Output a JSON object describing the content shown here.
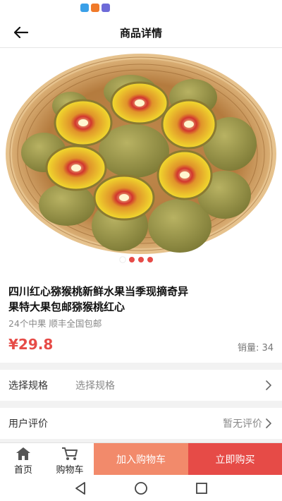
{
  "header": {
    "title": "商品详情"
  },
  "gallery": {
    "active_index": 0,
    "dot_count": 4
  },
  "product": {
    "title": "四川红心猕猴桃新鲜水果当季现摘奇异果特大果包邮猕猴桃红心",
    "title_line1": "四川红心猕猴桃新鲜水果当季现摘奇异",
    "title_line2": "果特大果包邮猕猴桃红心",
    "subtitle": "24个中果 顺丰全国包邮",
    "price": "¥29.8",
    "sales_label": "销量: ",
    "sales_count": "34"
  },
  "spec_row": {
    "label": "选择规格",
    "value": "选择规格"
  },
  "review_row": {
    "label": "用户评价",
    "value": "暂无评价"
  },
  "bottom": {
    "home_label": "首页",
    "cart_label": "购物车",
    "add_cart_label": "加入购物车",
    "buy_now_label": "立即购买"
  },
  "colors": {
    "accent": "#e64b47",
    "accent_light": "#f28a6b",
    "dot_active": "#ffffff",
    "dot_inactive": "#e64b47"
  },
  "icons": {
    "back": "arrow-left-icon",
    "chevron": "chevron-right-icon",
    "home": "home-icon",
    "cart": "cart-icon"
  }
}
